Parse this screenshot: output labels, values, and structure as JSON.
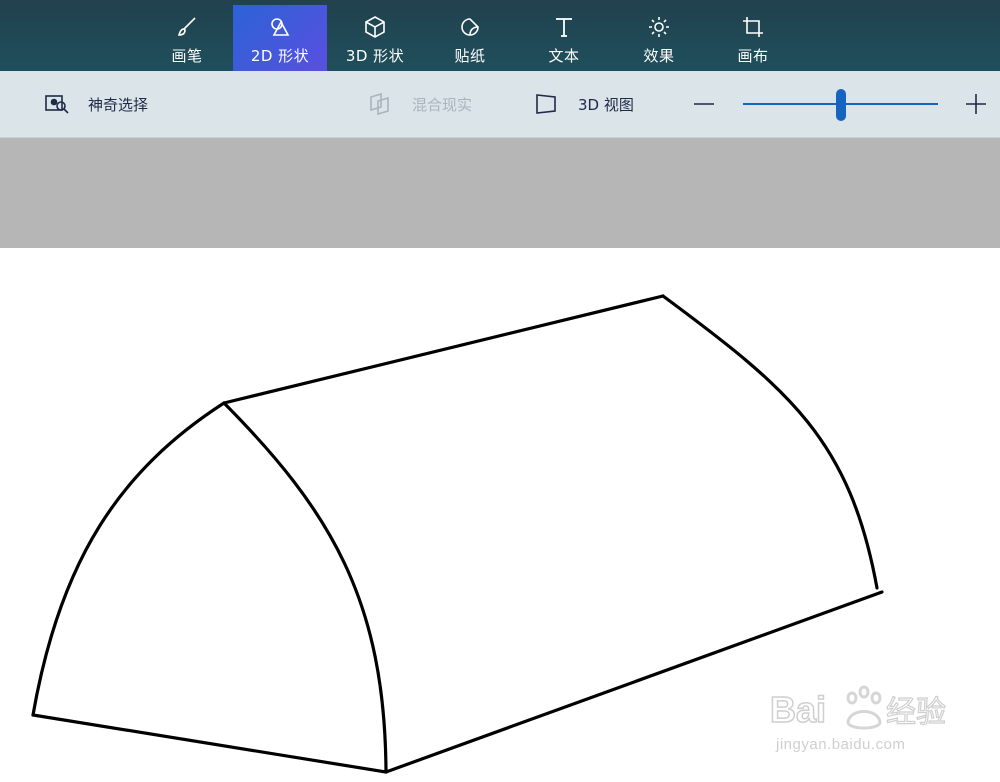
{
  "tabs": [
    {
      "label": "画笔",
      "icon": "brush-icon"
    },
    {
      "label": "2D 形状",
      "icon": "shapes-2d-icon",
      "active": true
    },
    {
      "label": "3D 形状",
      "icon": "cube-icon"
    },
    {
      "label": "贴纸",
      "icon": "sticker-icon"
    },
    {
      "label": "文本",
      "icon": "text-icon"
    },
    {
      "label": "效果",
      "icon": "sun-icon"
    },
    {
      "label": "画布",
      "icon": "crop-icon"
    }
  ],
  "toolbar": {
    "magic_select": "神奇选择",
    "mixed_reality": "混合现实",
    "view_3d": "3D 视图"
  },
  "zoom": {
    "level": 0.5
  },
  "colors": {
    "topbar": "#21414d",
    "active_tab": "#3d5ad9",
    "toolbar": "#dbe4e8",
    "accent": "#1565c0",
    "gray_area": "#b5b6b5"
  },
  "watermark": {
    "text": "Bai 经验",
    "url": "jingyan.baidu.com"
  }
}
